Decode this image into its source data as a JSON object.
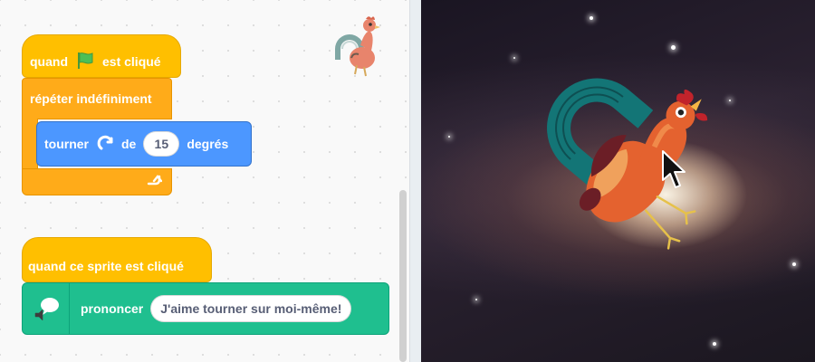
{
  "code": {
    "script1": {
      "hat_prefix": "quand",
      "hat_icon": "green-flag-icon",
      "hat_suffix": "est cliqué",
      "loop_label": "répéter indéfiniment",
      "loop_end_icon": "loop-arrow-icon",
      "turn_label": "tourner",
      "turn_icon": "rotate-right-icon",
      "turn_de": "de",
      "turn_value": "15",
      "turn_unit": "degrés"
    },
    "script2": {
      "hat_label": "quand ce sprite est cliqué",
      "say_icon": "speech-bubble-icon",
      "say_label": "prononcer",
      "say_value": "J'aime tourner sur moi-même!"
    },
    "sprite_thumbnail": "rooster-icon"
  },
  "stage": {
    "backdrop": "galaxy",
    "sprite": "rooster"
  },
  "colors": {
    "events": "#ffbf00",
    "control": "#ffab19",
    "motion": "#4c97ff",
    "looks": "#1fbf8f"
  }
}
